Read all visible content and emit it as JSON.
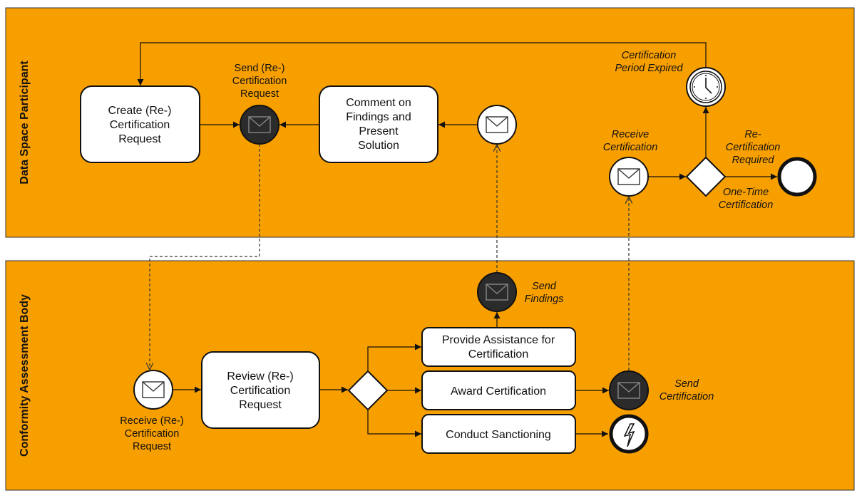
{
  "colors": {
    "pool": "#F89F00",
    "task_fill": "#FFFFFF",
    "throw_event": "#2B2B2B",
    "stroke": "#111111"
  },
  "pools": {
    "upper": "Data Space Participant",
    "lower": "Conformity Assessment Body"
  },
  "upper": {
    "create_task": [
      "Create (Re-)",
      "Certification",
      "Request"
    ],
    "send_request_event": [
      "Send (Re-)",
      "Certification",
      "Request"
    ],
    "comment_task": [
      "Comment on",
      "Findings and",
      "Present",
      "Solution"
    ],
    "timer_event": [
      "Certification",
      "Period Expired"
    ],
    "receive_cert_event": [
      "Receive",
      "Certification"
    ],
    "gateway_recert": [
      "Re-",
      "Certification",
      "Required"
    ],
    "gateway_onetime": [
      "One-Time",
      "Certification"
    ]
  },
  "lower": {
    "receive_request_event": [
      "Receive (Re-)",
      "Certification",
      "Request"
    ],
    "review_task": [
      "Review (Re-)",
      "Certification",
      "Request"
    ],
    "assist_task": [
      "Provide Assistance for",
      "Certification"
    ],
    "award_task": "Award Certification",
    "sanction_task": "Conduct Sanctioning",
    "send_findings_event": [
      "Send",
      "Findings"
    ],
    "send_cert_event": [
      "Send",
      "Certification"
    ]
  },
  "icons": {
    "message": "envelope-icon",
    "timer": "clock-icon",
    "error": "lightning-icon"
  }
}
